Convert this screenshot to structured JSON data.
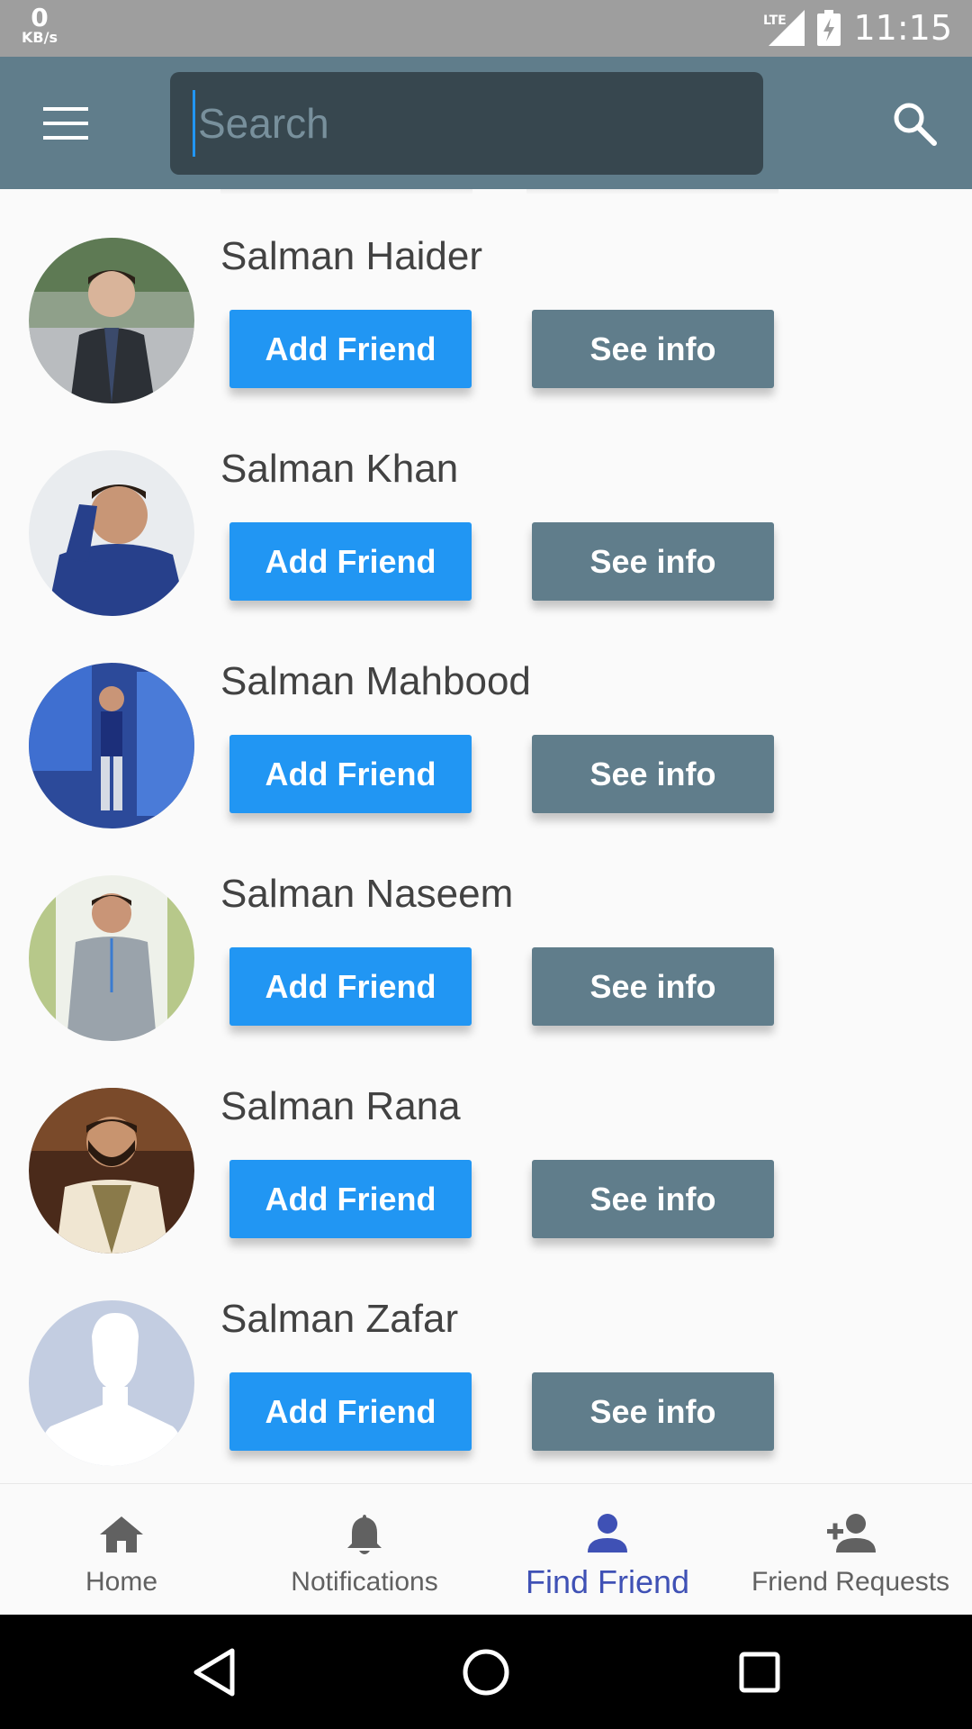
{
  "status_bar": {
    "net_speed_value": "0",
    "net_speed_unit": "KB/s",
    "network_label": "LTE",
    "time": "11:15"
  },
  "toolbar": {
    "menu_icon": "hamburger-menu-icon",
    "search_placeholder": "Search",
    "search_value": "",
    "search_icon": "search-icon",
    "color": "#607d8b",
    "search_box_color": "#37474f"
  },
  "people": [
    {
      "name": "Salman Haider",
      "add_label": "Add Friend",
      "info_label": "See info"
    },
    {
      "name": "Salman Khan",
      "add_label": "Add Friend",
      "info_label": "See info"
    },
    {
      "name": "Salman Mahbood",
      "add_label": "Add Friend",
      "info_label": "See info"
    },
    {
      "name": "Salman Naseem",
      "add_label": "Add Friend",
      "info_label": "See info"
    },
    {
      "name": "Salman Rana",
      "add_label": "Add Friend",
      "info_label": "See info"
    },
    {
      "name": "Salman Zafar",
      "add_label": "Add Friend",
      "info_label": "See info"
    }
  ],
  "colors": {
    "add_button": "#2196f3",
    "info_button": "#607d8b",
    "active_nav": "#3f51b5",
    "inactive_nav": "#616161"
  },
  "bottom_nav": [
    {
      "label": "Home",
      "icon": "home-icon",
      "active": false
    },
    {
      "label": "Notifications",
      "icon": "bell-icon",
      "active": false
    },
    {
      "label": "Find Friend",
      "icon": "person-icon",
      "active": true
    },
    {
      "label": "Friend Requests",
      "icon": "person-add-icon",
      "active": false
    }
  ],
  "system_nav": {
    "back_icon": "back-triangle-icon",
    "home_icon": "home-circle-icon",
    "recents_icon": "recents-square-icon"
  }
}
